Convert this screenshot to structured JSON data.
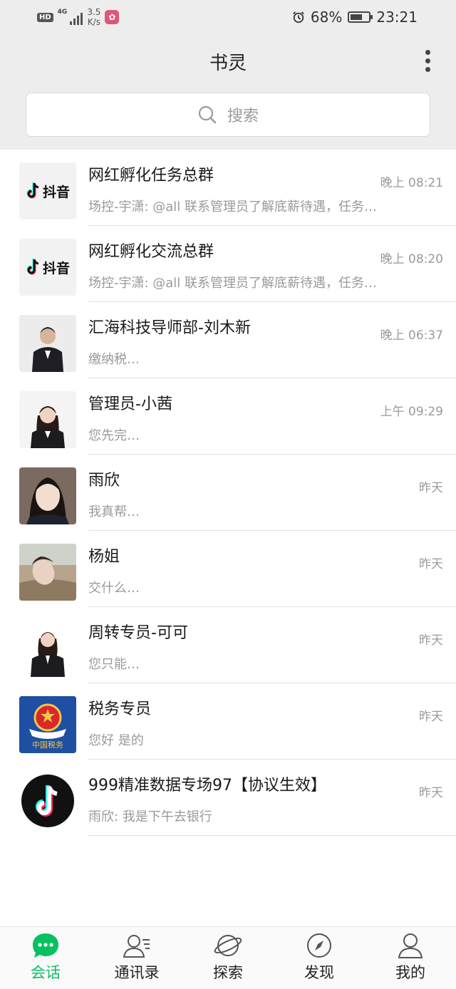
{
  "status_bar": {
    "hd": "HD",
    "network": "4G",
    "speed_value": "3.5",
    "speed_unit": "K/s",
    "battery": "68%",
    "battery_level": 0.68,
    "time": "23:21"
  },
  "header": {
    "title": "书灵",
    "search_placeholder": "搜索"
  },
  "conversations": [
    {
      "title": "网红孵化任务总群",
      "preview": "场控-宇潇: @all 联系管理员了解底薪待遇，任务…",
      "time": "晚上 08:21",
      "avatar_brand": "抖音"
    },
    {
      "title": "网红孵化交流总群",
      "preview": "场控-宇潇: @all 联系管理员了解底薪待遇，任务…",
      "time": "晚上 08:20",
      "avatar_brand": "抖音"
    },
    {
      "title": "汇海科技导师部-刘木新",
      "preview": "缴纳税…",
      "time": "晚上 06:37"
    },
    {
      "title": "管理员-小茜",
      "preview": "您先完…",
      "time": "上午 09:29"
    },
    {
      "title": "雨欣",
      "preview": "我真帮…",
      "time": "昨天"
    },
    {
      "title": "杨姐",
      "preview": "交什么…",
      "time": "昨天"
    },
    {
      "title": "周转专员-可可",
      "preview": "您只能…",
      "time": "昨天"
    },
    {
      "title": "税务专员",
      "preview": "您好 是的",
      "time": "昨天",
      "avatar_text": "中国税务"
    },
    {
      "title": "999精准数据专场97【协议生效】",
      "preview": "雨欣: 我是下午去银行",
      "time": "昨天"
    }
  ],
  "tabs": [
    {
      "label": "会话",
      "icon": "chat-bubble-icon"
    },
    {
      "label": "通讯录",
      "icon": "contacts-icon"
    },
    {
      "label": "探索",
      "icon": "planet-icon"
    },
    {
      "label": "发现",
      "icon": "compass-icon"
    },
    {
      "label": "我的",
      "icon": "person-icon"
    }
  ],
  "active_tab": 0,
  "colors": {
    "accent": "#07c160",
    "header_bg": "#ededed",
    "tiktok_cyan": "#25f4ee",
    "tiktok_red": "#fe2c55"
  }
}
